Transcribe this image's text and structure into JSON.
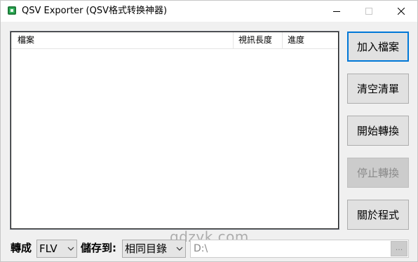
{
  "window": {
    "title": "QSV Exporter (QSV格式转换神器)"
  },
  "list": {
    "columns": [
      "檔案",
      "視訊長度",
      "進度"
    ],
    "rows": []
  },
  "buttons": {
    "add_files": "加入檔案",
    "clear_list": "清空清單",
    "start_convert": "開始轉換",
    "stop_convert": "停止轉換",
    "about": "關於程式"
  },
  "bottom": {
    "convert_label": "轉成",
    "format_value": "FLV",
    "save_label": "儲存到:",
    "location_value": "相同目錄",
    "path_value": "D:\\",
    "browse_label": "..."
  },
  "watermark": "qdzyk.com",
  "colors": {
    "focus_border": "#0078d7",
    "disabled_text": "#8a8a8a"
  },
  "icons": {
    "app": "app-icon",
    "minimize": "minimize-icon",
    "maximize": "maximize-icon",
    "close": "close-icon",
    "dropdown": "chevron-down-icon"
  }
}
